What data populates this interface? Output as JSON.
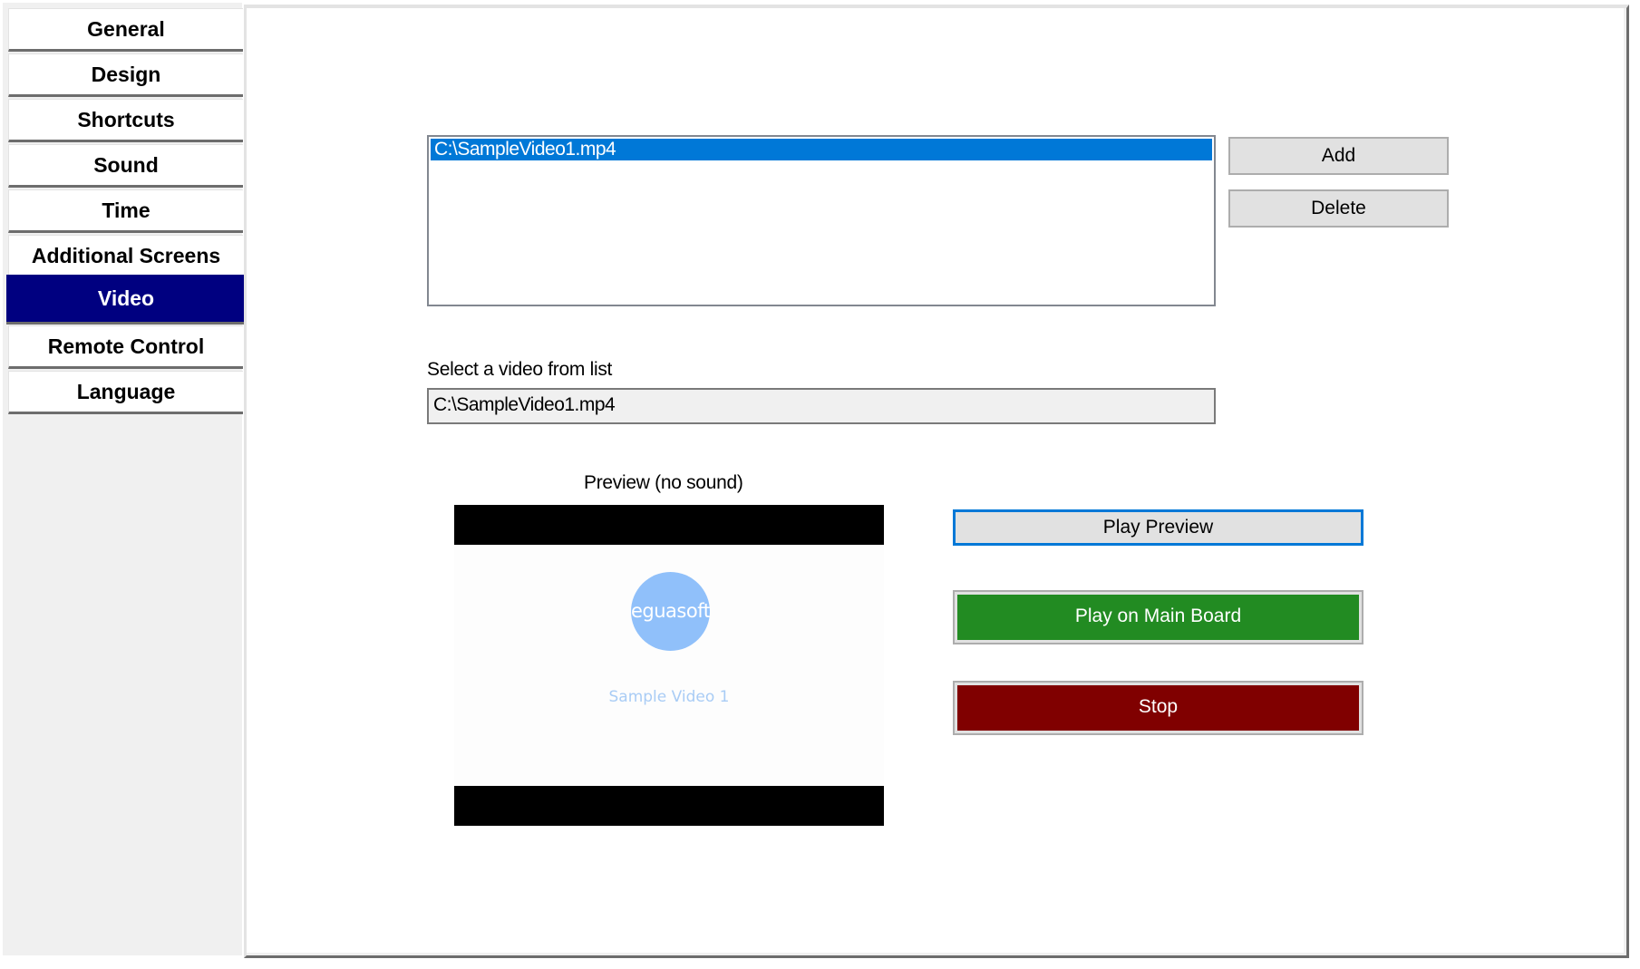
{
  "sidebar": {
    "items": [
      {
        "label": "General",
        "selected": false
      },
      {
        "label": "Design",
        "selected": false
      },
      {
        "label": "Shortcuts",
        "selected": false
      },
      {
        "label": "Sound",
        "selected": false
      },
      {
        "label": "Time",
        "selected": false
      },
      {
        "label": "Additional Screens",
        "selected": false
      },
      {
        "label": "Video",
        "selected": true
      },
      {
        "label": "Remote Control",
        "selected": false
      },
      {
        "label": "Language",
        "selected": false
      }
    ],
    "selected_color": "#000080"
  },
  "video_list": {
    "items": [
      "C:\\SampleVideo1.mp4"
    ],
    "selected_index": 0,
    "selection_color": "#0078d7"
  },
  "buttons": {
    "add": "Add",
    "delete": "Delete",
    "play_preview": "Play Preview",
    "play_main": "Play on Main Board",
    "stop": "Stop"
  },
  "colors": {
    "play_main_bg": "#228b22",
    "stop_bg": "#800000",
    "focus_border": "#0078d7"
  },
  "selected_video": {
    "label": "Select a video from list",
    "value": "C:\\SampleVideo1.mp4"
  },
  "preview": {
    "label": "Preview (no sound)",
    "logo_text": "eguasoft",
    "caption": "Sample Video 1"
  }
}
